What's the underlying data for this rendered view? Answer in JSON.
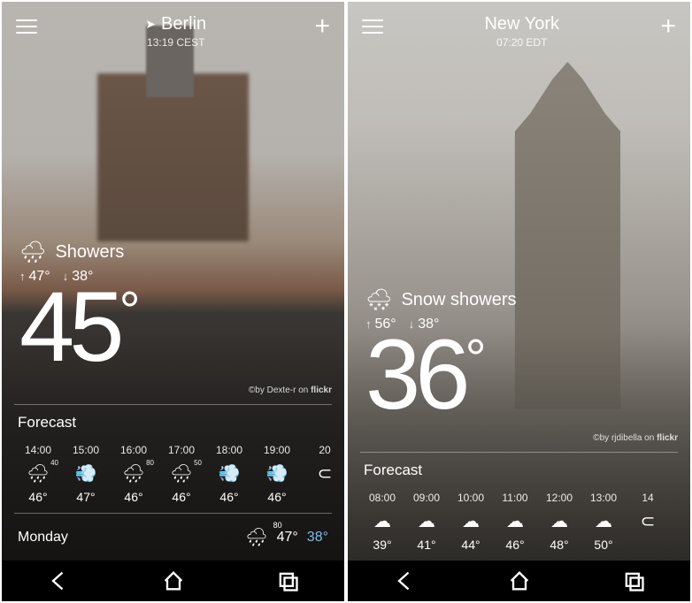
{
  "left": {
    "city": "Berlin",
    "time": "13:19 CEST",
    "has_location_arrow": true,
    "condition": "Showers",
    "condition_icon": "rain",
    "high": "47°",
    "low": "38°",
    "temp": "45",
    "credit_by": "©by Dexte-r on ",
    "credit_brand": "flickr",
    "forecast_label": "Forecast",
    "hourly": [
      {
        "t": "14:00",
        "icon": "rain",
        "pop": "40",
        "temp": "46°"
      },
      {
        "t": "15:00",
        "icon": "wind",
        "pop": "",
        "temp": "47°"
      },
      {
        "t": "16:00",
        "icon": "rain",
        "pop": "80",
        "temp": "46°"
      },
      {
        "t": "17:00",
        "icon": "rain",
        "pop": "50",
        "temp": "46°"
      },
      {
        "t": "18:00",
        "icon": "wind",
        "pop": "",
        "temp": "46°"
      },
      {
        "t": "19:00",
        "icon": "wind",
        "pop": "",
        "temp": "46°"
      },
      {
        "t": "20",
        "icon": "cloud-partial",
        "pop": "",
        "temp": ""
      }
    ],
    "day": {
      "name": "Monday",
      "icon": "rain",
      "pop": "80",
      "hi": "47°",
      "lo": "38°"
    }
  },
  "right": {
    "city": "New York",
    "time": "07:20 EDT",
    "has_location_arrow": false,
    "condition": "Snow showers",
    "condition_icon": "snow",
    "high": "56°",
    "low": "38°",
    "temp": "36",
    "credit_by": "©by rjdibella on ",
    "credit_brand": "flickr",
    "forecast_label": "Forecast",
    "hourly": [
      {
        "t": "08:00",
        "icon": "cloud",
        "pop": "",
        "temp": "39°"
      },
      {
        "t": "09:00",
        "icon": "cloud",
        "pop": "",
        "temp": "41°"
      },
      {
        "t": "10:00",
        "icon": "cloud",
        "pop": "",
        "temp": "44°"
      },
      {
        "t": "11:00",
        "icon": "cloud",
        "pop": "",
        "temp": "46°"
      },
      {
        "t": "12:00",
        "icon": "cloud",
        "pop": "",
        "temp": "48°"
      },
      {
        "t": "13:00",
        "icon": "cloud",
        "pop": "",
        "temp": "50°"
      },
      {
        "t": "14",
        "icon": "cloud-partial",
        "pop": "",
        "temp": ""
      }
    ]
  },
  "icons": {
    "rain": "🌧",
    "wind": "💨",
    "cloud": "☁",
    "snow": "🌨",
    "cloud-partial": "⊂"
  }
}
